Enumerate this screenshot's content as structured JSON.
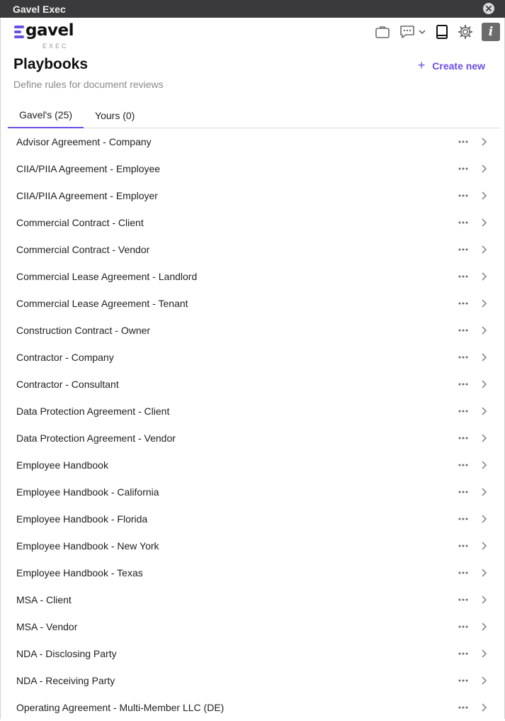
{
  "window": {
    "title": "Gavel Exec"
  },
  "logo": {
    "wordmark": "gavel",
    "sub": "EXEC"
  },
  "accent": "#6c4de6",
  "toolbar": {
    "icons": [
      "briefcase-icon",
      "chat-icon",
      "chevron-down-icon",
      "book-icon",
      "gear-icon",
      "info-icon"
    ],
    "info_glyph": "i"
  },
  "page": {
    "title": "Playbooks",
    "subtitle": "Define rules for document reviews",
    "create_label": "Create new"
  },
  "tabs": [
    {
      "label": "Gavel's (25)",
      "active": true
    },
    {
      "label": "Yours (0)",
      "active": false
    }
  ],
  "playbooks": [
    {
      "label": "Advisor Agreement - Company"
    },
    {
      "label": "CIIA/PIIA Agreement - Employee"
    },
    {
      "label": "CIIA/PIIA Agreement - Employer"
    },
    {
      "label": "Commercial Contract - Client"
    },
    {
      "label": "Commercial Contract - Vendor"
    },
    {
      "label": "Commercial Lease Agreement - Landlord"
    },
    {
      "label": "Commercial Lease Agreement - Tenant"
    },
    {
      "label": "Construction Contract - Owner"
    },
    {
      "label": "Contractor - Company"
    },
    {
      "label": "Contractor - Consultant"
    },
    {
      "label": "Data Protection Agreement - Client"
    },
    {
      "label": "Data Protection Agreement - Vendor"
    },
    {
      "label": "Employee Handbook"
    },
    {
      "label": "Employee Handbook - California"
    },
    {
      "label": "Employee Handbook - Florida"
    },
    {
      "label": "Employee Handbook - New York"
    },
    {
      "label": "Employee Handbook - Texas"
    },
    {
      "label": "MSA - Client"
    },
    {
      "label": "MSA - Vendor"
    },
    {
      "label": "NDA - Disclosing Party"
    },
    {
      "label": "NDA - Receiving Party"
    },
    {
      "label": "Operating Agreement - Multi-Member LLC (DE)"
    }
  ]
}
